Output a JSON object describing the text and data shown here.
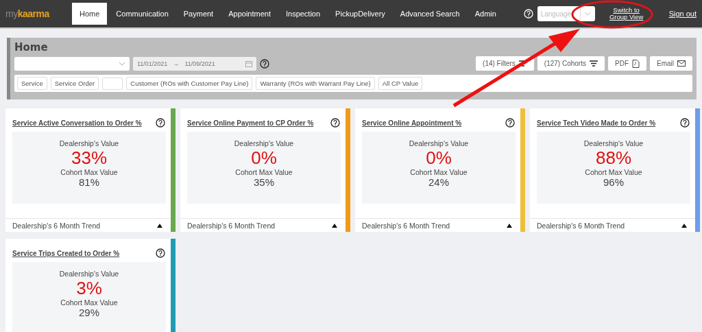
{
  "navbar": {
    "logo": {
      "prefix": "my",
      "name": "kaarma"
    },
    "tabs": [
      {
        "label": "Home",
        "selected": true
      },
      {
        "label": "Communication",
        "selected": false
      },
      {
        "label": "Payment",
        "selected": false
      },
      {
        "label": "Appointment",
        "selected": false
      },
      {
        "label": "Inspection",
        "selected": false
      },
      {
        "label": "PickupDelivery",
        "selected": false
      },
      {
        "label": "Advanced Search",
        "selected": false
      },
      {
        "label": "Admin",
        "selected": false
      }
    ],
    "language": {
      "placeholder": "Language"
    },
    "switch_link": "Switch to Group View",
    "sign_out": "Sign out"
  },
  "header": {
    "title": "Home",
    "date_from": "11/01/2021",
    "date_to": "11/09/2021",
    "date_arrow": "→",
    "buttons": [
      {
        "label": "(14) Filters",
        "kind": "filter"
      },
      {
        "label": "(127) Cohorts",
        "kind": "filter"
      },
      {
        "label": "PDF",
        "kind": "pdf"
      },
      {
        "label": "Email",
        "kind": "email"
      }
    ],
    "chips": [
      {
        "label": "Service",
        "kind": "text"
      },
      {
        "label": "Service Order",
        "kind": "text"
      },
      {
        "kind": "blank"
      },
      {
        "label": "Customer (ROs with Customer Pay Line)",
        "kind": "text"
      },
      {
        "label": "Warranty (ROs with Warrant Pay Line)",
        "kind": "text"
      },
      {
        "label": "All CP Value",
        "kind": "text"
      }
    ]
  },
  "cards": [
    {
      "title": "Service Active Conversation to Order %",
      "color": "#6aa84f",
      "value_label": "Dealership's Value",
      "value": "33%",
      "max_label": "Cohort Max Value",
      "max_value": "81%",
      "trend": "Dealership's 6 Month Trend"
    },
    {
      "title": "Service Online Payment to CP Order %",
      "color": "#f09a1a",
      "value_label": "Dealership's Value",
      "value": "0%",
      "max_label": "Cohort Max Value",
      "max_value": "35%",
      "trend": "Dealership's 6 Month Trend"
    },
    {
      "title": "Service Online Appointment %",
      "color": "#ecc03a",
      "value_label": "Dealership's Value",
      "value": "0%",
      "max_label": "Cohort Max Value",
      "max_value": "24%",
      "trend": "Dealership's 6 Month Trend"
    },
    {
      "title": "Service Tech Video Made to Order %",
      "color": "#6d9eeb",
      "value_label": "Dealership's Value",
      "value": "88%",
      "max_label": "Cohort Max Value",
      "max_value": "96%",
      "trend": "Dealership's 6 Month Trend"
    },
    {
      "title": "Service Trips Created to Order %",
      "color": "#1f9bb3",
      "value_label": "Dealership's Value",
      "value": "3%",
      "max_label": "Cohort Max Value",
      "max_value": "29%"
    }
  ]
}
